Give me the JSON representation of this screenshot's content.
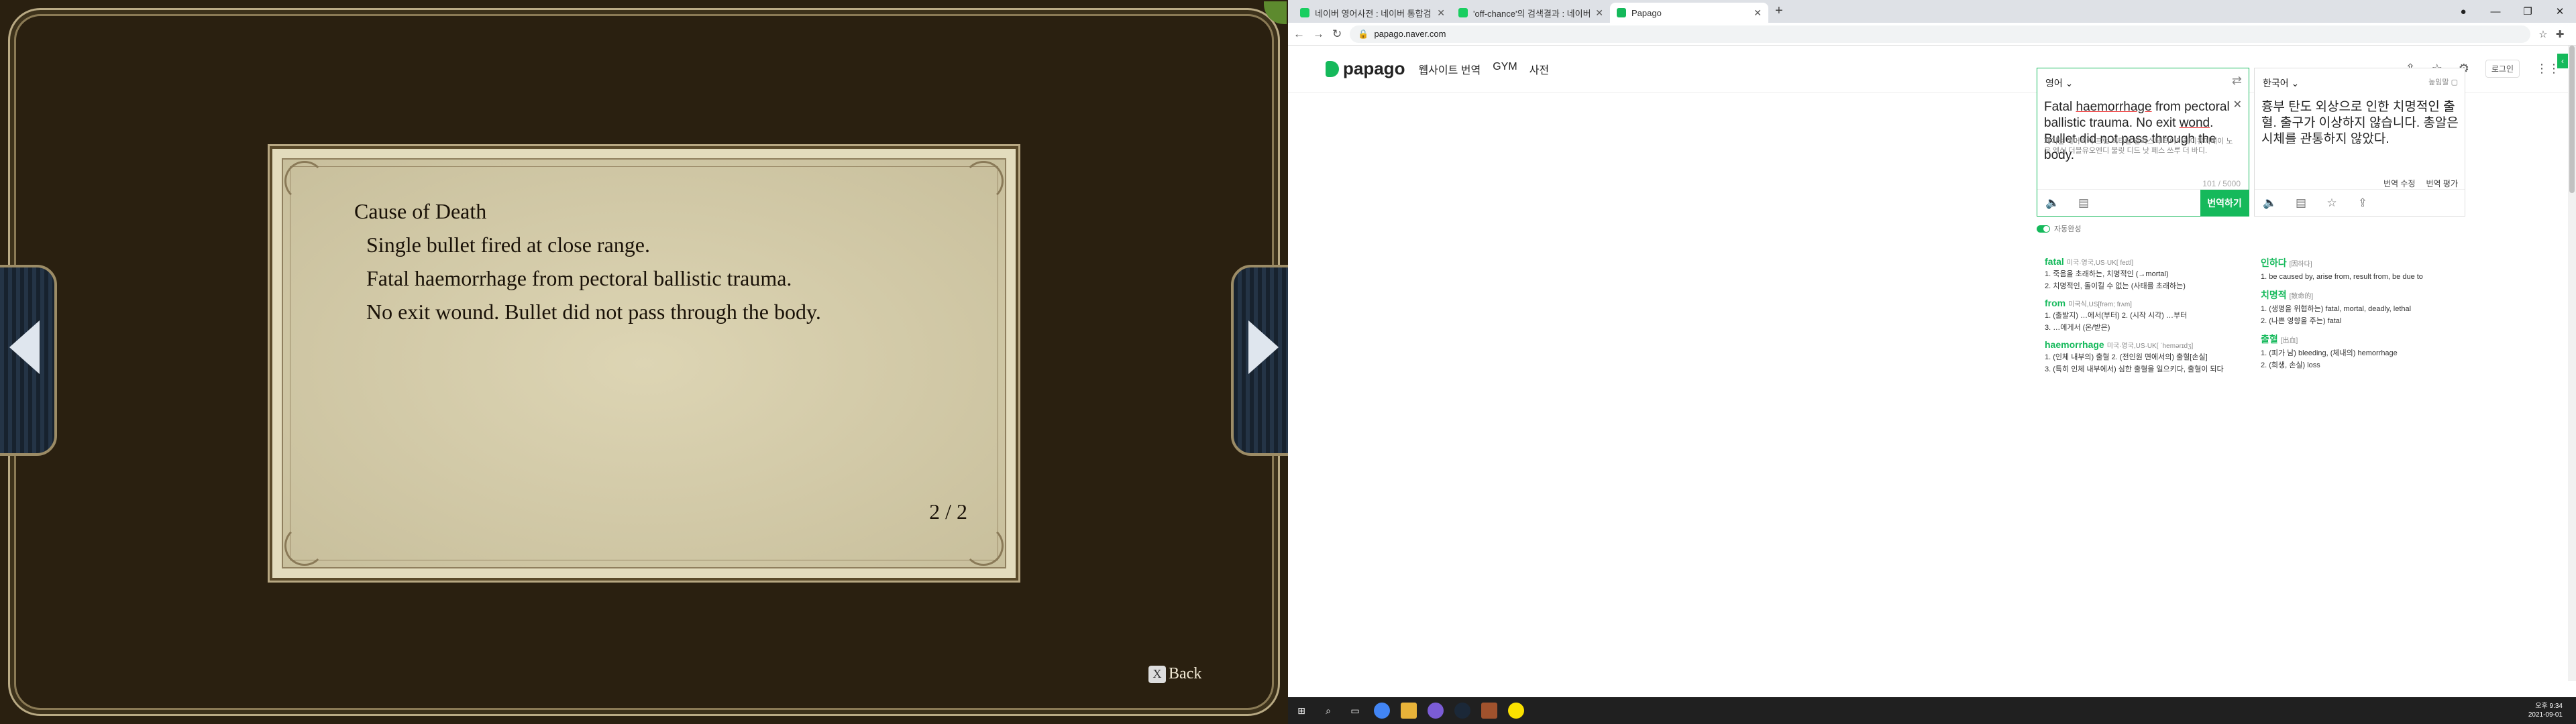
{
  "game": {
    "evidence_lines": [
      "Cause of Death",
      "Single bullet fired at close range.",
      "Fatal haemorrhage from pectoral ballistic trauma.",
      "No exit wound. Bullet did not pass through the body."
    ],
    "page_number": "2 / 2",
    "back_key": "X",
    "back_label": "Back"
  },
  "browser": {
    "tabs": [
      {
        "title": "네이버 영어사전 : 네이버 통합검색",
        "active": false,
        "favicon_color": "#19ce60"
      },
      {
        "title": "'off-chance'의 검색결과 : 네이버 사전",
        "active": false,
        "favicon_color": "#19ce60"
      },
      {
        "title": "Papago",
        "active": true,
        "favicon_color": "#15b95b"
      }
    ],
    "url": "papago.naver.com",
    "header": {
      "logo": "papago",
      "nav": [
        "웹사이트 번역",
        "GYM",
        "사전"
      ],
      "login": "로그인"
    },
    "source": {
      "lang": "영어",
      "text_before": "Fatal ",
      "text_ul1": "haemorrhage",
      "text_mid": " from pectoral ballistic trauma. No exit ",
      "text_ul2": "wond",
      "text_after": ". Bullet did not pass through the body.",
      "pronunciation": "페이털 헤머리지 프럼 펙터럴 발리스틱 티아마레이유메베이 노우 엑싯 더블유오엔디 불릿 디드 낫 페스 쓰루 더 바디.",
      "count": "101 / 5000",
      "translate_btn": "번역하기"
    },
    "target": {
      "lang": "한국어",
      "honorific": "높임말",
      "text": "흉부 탄도 외상으로 인한 치명적인 출혈. 출구가 이상하지 않습니다. 총알은 시체를 관통하지 않았다.",
      "edit": "번역 수정",
      "rate": "번역 평가"
    },
    "autocomplete": "자동완성",
    "dict_left": [
      {
        "word": "fatal",
        "phon": "미국·영국,US·UK[ feɪtl]",
        "meanings": [
          "1. 죽음을 초래하는, 치명적인 (→mortal)",
          "2. 치명적인, 돌이킬 수 없는 (사태를 초래하는)"
        ]
      },
      {
        "word": "from",
        "phon": "미국식,US[frəm; frʌm]",
        "meanings": [
          "1. (출발지) …에서(부터)   2. (시작 시각) …부터",
          "3. …에게서 (온/받은)"
        ]
      },
      {
        "word": "haemorrhage",
        "phon": "미국·영국,US·UK[ ˈhemərɪdʒ]",
        "meanings": [
          "1. (인체 내부의) 출혈  2. (전인원 면에서의) 출혈[손실]",
          "3. (특히 인체 내부에서) 심한 출혈을 일으키다, 출혈이 되다"
        ]
      }
    ],
    "dict_right": [
      {
        "word": "인하다",
        "phon": "[因하다]",
        "meanings": [
          "1. be caused by, arise from, result from, be due to"
        ]
      },
      {
        "word": "치명적",
        "phon": "[致命的]",
        "meanings": [
          "1. (생명을 위협하는) fatal, mortal, deadly, lethal",
          "2. (나쁜 영향을 주는) fatal"
        ]
      },
      {
        "word": "출혈",
        "phon": "[出血]",
        "meanings": [
          "1. (피가 남) bleeding, (체내의) hemorrhage",
          "2. (희생, 손실) loss"
        ]
      }
    ],
    "clock": {
      "time": "오후 9:34",
      "date": "2021-09-01"
    }
  }
}
